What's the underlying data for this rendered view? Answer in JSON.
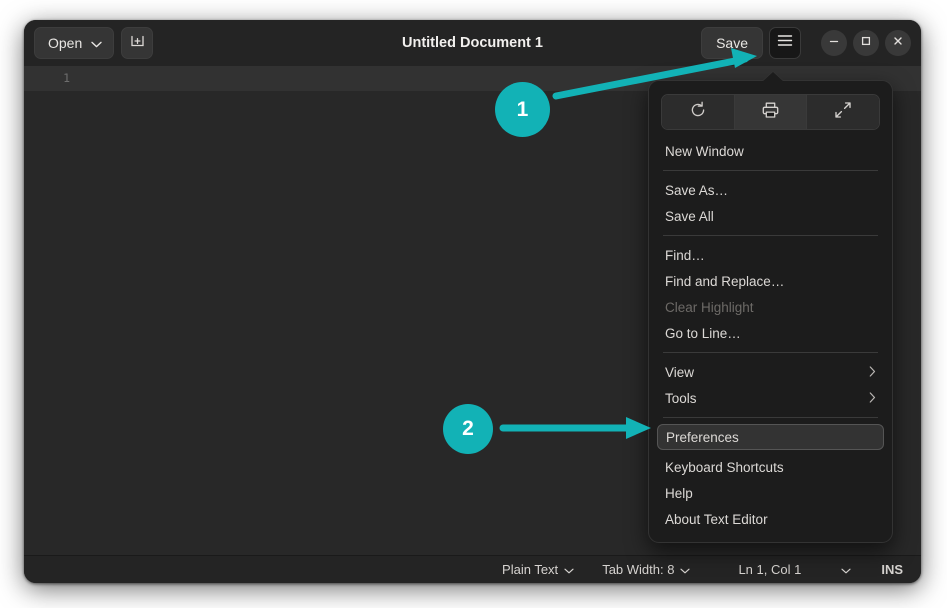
{
  "window": {
    "title": "Untitled Document 1"
  },
  "header": {
    "open_label": "Open",
    "open_chevron": "chevron-down-icon",
    "new_tab_icon": "new-tab-icon",
    "save_label": "Save",
    "menu_icon": "hamburger-menu-icon",
    "minimize_icon": "minimize-icon",
    "maximize_icon": "maximize-icon",
    "close_icon": "close-icon"
  },
  "editor": {
    "line_number": "1",
    "content": ""
  },
  "statusbar": {
    "language": "Plain Text",
    "tab_width": "Tab Width: 8",
    "position": "Ln 1, Col 1",
    "insert_mode": "INS"
  },
  "menu": {
    "toolbar": [
      {
        "name": "reload-icon",
        "label": "Reload"
      },
      {
        "name": "print-icon",
        "label": "Print"
      },
      {
        "name": "fullscreen-icon",
        "label": "Fullscreen"
      }
    ],
    "items": [
      {
        "label": "New Window",
        "state": "normal",
        "submenu": false
      },
      {
        "label": "Save As…",
        "state": "normal",
        "submenu": false
      },
      {
        "label": "Save All",
        "state": "normal",
        "submenu": false
      },
      {
        "label": "Find…",
        "state": "normal",
        "submenu": false
      },
      {
        "label": "Find and Replace…",
        "state": "normal",
        "submenu": false
      },
      {
        "label": "Clear Highlight",
        "state": "disabled",
        "submenu": false
      },
      {
        "label": "Go to Line…",
        "state": "normal",
        "submenu": false
      },
      {
        "label": "View",
        "state": "normal",
        "submenu": true
      },
      {
        "label": "Tools",
        "state": "normal",
        "submenu": true
      },
      {
        "label": "Preferences",
        "state": "selected",
        "submenu": false
      },
      {
        "label": "Keyboard Shortcuts",
        "state": "normal",
        "submenu": false
      },
      {
        "label": "Help",
        "state": "normal",
        "submenu": false
      },
      {
        "label": "About Text Editor",
        "state": "normal",
        "submenu": false
      }
    ],
    "submenu_arrow": "chevron-right-icon"
  },
  "annotations": {
    "accent_color": "#12b2b6",
    "steps": [
      {
        "number": "1",
        "target": "hamburger-menu-icon"
      },
      {
        "number": "2",
        "target": "Preferences"
      }
    ]
  }
}
